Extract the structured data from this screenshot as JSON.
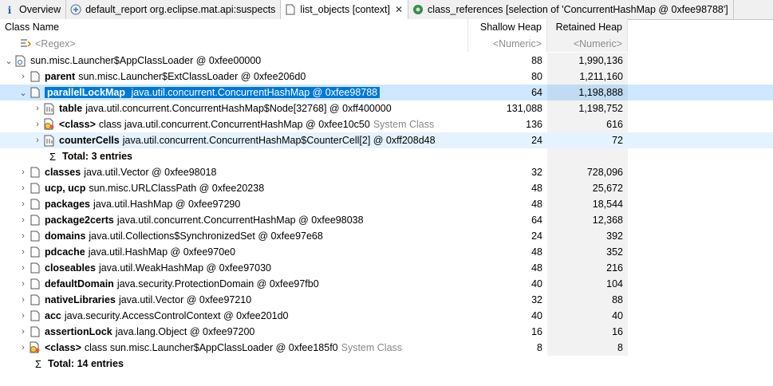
{
  "tabs": [
    {
      "label": "Overview"
    },
    {
      "label": "default_report  org.eclipse.mat.api:suspects"
    },
    {
      "label": "list_objects [context]",
      "close": "✕"
    },
    {
      "label": "class_references [selection of 'ConcurrentHashMap @ 0xfee98788']"
    }
  ],
  "columns": {
    "name": "Class Name",
    "shallow": "Shallow Heap",
    "retained": "Retained Heap"
  },
  "filter": {
    "name": "<Regex>",
    "shallow": "<Numeric>",
    "retained": "<Numeric>"
  },
  "rows": [
    {
      "field": "",
      "cls": "sun.misc.Launcher$AppClassLoader @ 0xfee00000",
      "sys": "",
      "shallow": "88",
      "retained": "1,990,136"
    },
    {
      "field": "parent",
      "cls": "sun.misc.Launcher$ExtClassLoader @ 0xfee206d0",
      "sys": "",
      "shallow": "80",
      "retained": "1,211,160"
    },
    {
      "field": "parallelLockMap",
      "cls": "java.util.concurrent.ConcurrentHashMap @ 0xfee98788",
      "sys": "",
      "shallow": "64",
      "retained": "1,198,888"
    },
    {
      "field": "table",
      "cls": "java.util.concurrent.ConcurrentHashMap$Node[32768] @ 0xff400000",
      "sys": "",
      "shallow": "131,088",
      "retained": "1,198,752"
    },
    {
      "field": "<class>",
      "cls": "class java.util.concurrent.ConcurrentHashMap @ 0xfee10c50",
      "sys": "System Class",
      "shallow": "136",
      "retained": "616"
    },
    {
      "field": "counterCells",
      "cls": "java.util.concurrent.ConcurrentHashMap$CounterCell[2] @ 0xff208d48",
      "sys": "",
      "shallow": "24",
      "retained": "72"
    },
    {
      "total": "Total: 3 entries"
    },
    {
      "field": "classes",
      "cls": "java.util.Vector @ 0xfee98018",
      "sys": "",
      "shallow": "32",
      "retained": "728,096"
    },
    {
      "field": "ucp, ucp",
      "cls": "sun.misc.URLClassPath @ 0xfee20238",
      "sys": "",
      "shallow": "48",
      "retained": "25,672"
    },
    {
      "field": "packages",
      "cls": "java.util.HashMap @ 0xfee97290",
      "sys": "",
      "shallow": "48",
      "retained": "18,544"
    },
    {
      "field": "package2certs",
      "cls": "java.util.concurrent.ConcurrentHashMap @ 0xfee98038",
      "sys": "",
      "shallow": "64",
      "retained": "12,368"
    },
    {
      "field": "domains",
      "cls": "java.util.Collections$SynchronizedSet @ 0xfee97e68",
      "sys": "",
      "shallow": "24",
      "retained": "392"
    },
    {
      "field": "pdcache",
      "cls": "java.util.HashMap @ 0xfee970e0",
      "sys": "",
      "shallow": "48",
      "retained": "352"
    },
    {
      "field": "closeables",
      "cls": "java.util.WeakHashMap @ 0xfee97030",
      "sys": "",
      "shallow": "48",
      "retained": "216"
    },
    {
      "field": "defaultDomain",
      "cls": "java.security.ProtectionDomain @ 0xfee97fb0",
      "sys": "",
      "shallow": "40",
      "retained": "104"
    },
    {
      "field": "nativeLibraries",
      "cls": "java.util.Vector @ 0xfee97210",
      "sys": "",
      "shallow": "32",
      "retained": "88"
    },
    {
      "field": "acc",
      "cls": "java.security.AccessControlContext @ 0xfee201d0",
      "sys": "",
      "shallow": "40",
      "retained": "40"
    },
    {
      "field": "assertionLock",
      "cls": "java.lang.Object @ 0xfee97200",
      "sys": "",
      "shallow": "16",
      "retained": "16"
    },
    {
      "field": "<class>",
      "cls": "class sun.misc.Launcher$AppClassLoader @ 0xfee185f0",
      "sys": "System Class",
      "shallow": "8",
      "retained": "8"
    },
    {
      "total": "Total: 14 entries"
    }
  ],
  "colors": {
    "selection": "#0078d7",
    "system_class": "#888888"
  }
}
